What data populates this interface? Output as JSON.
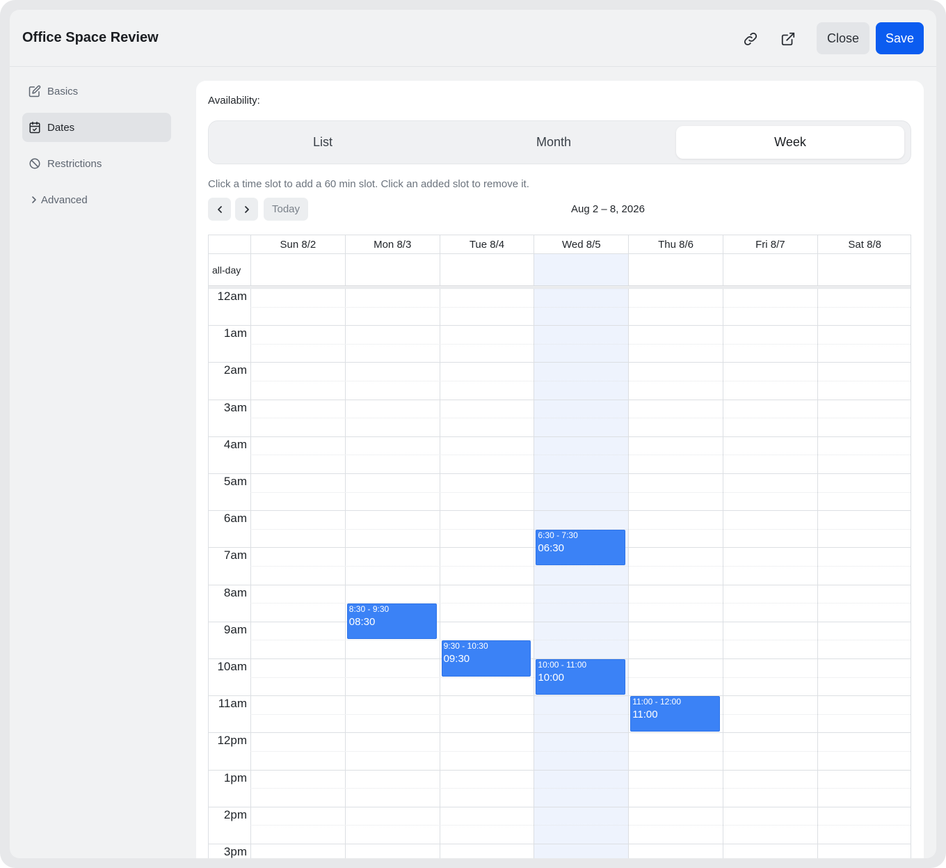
{
  "header": {
    "title": "Office Space Review",
    "close_label": "Close",
    "save_label": "Save",
    "icons": [
      "link-icon",
      "external-link-icon"
    ]
  },
  "sidebar": {
    "items": [
      {
        "label": "Basics",
        "icon": "edit-icon",
        "active": false
      },
      {
        "label": "Dates",
        "icon": "calendar-icon",
        "active": true
      },
      {
        "label": "Restrictions",
        "icon": "ban-icon",
        "active": false
      },
      {
        "label": "Advanced",
        "icon": "chevron-right-icon",
        "active": false
      }
    ]
  },
  "main": {
    "availability_label": "Availability:",
    "tabs": [
      {
        "label": "List",
        "active": false
      },
      {
        "label": "Month",
        "active": false
      },
      {
        "label": "Week",
        "active": true
      }
    ],
    "hint": "Click a time slot to add a 60 min slot. Click an added slot to remove it.",
    "today_label": "Today",
    "range": "Aug 2 – 8, 2026"
  },
  "calendar": {
    "days": [
      "Sun 8/2",
      "Mon 8/3",
      "Tue 8/4",
      "Wed 8/5",
      "Thu 8/6",
      "Fri 8/7",
      "Sat 8/8"
    ],
    "today_index": 3,
    "allday_label": "all-day",
    "hours": [
      "12am",
      "1am",
      "2am",
      "3am",
      "4am",
      "5am",
      "6am",
      "7am",
      "8am",
      "9am",
      "10am",
      "11am",
      "12pm",
      "1pm",
      "2pm",
      "3pm"
    ],
    "events": [
      {
        "day": 3,
        "start": 6.5,
        "end": 7.5,
        "time": "6:30 - 7:30",
        "label": "06:30"
      },
      {
        "day": 1,
        "start": 8.5,
        "end": 9.5,
        "time": "8:30 - 9:30",
        "label": "08:30"
      },
      {
        "day": 2,
        "start": 9.5,
        "end": 10.5,
        "time": "9:30 - 10:30",
        "label": "09:30"
      },
      {
        "day": 3,
        "start": 10,
        "end": 11,
        "time": "10:00 - 11:00",
        "label": "10:00"
      },
      {
        "day": 4,
        "start": 11,
        "end": 12,
        "time": "11:00 - 12:00",
        "label": "11:00"
      }
    ]
  },
  "colors": {
    "accent": "#0b5cf0",
    "event": "#3b82f6",
    "today_column": "#eef3fd"
  }
}
